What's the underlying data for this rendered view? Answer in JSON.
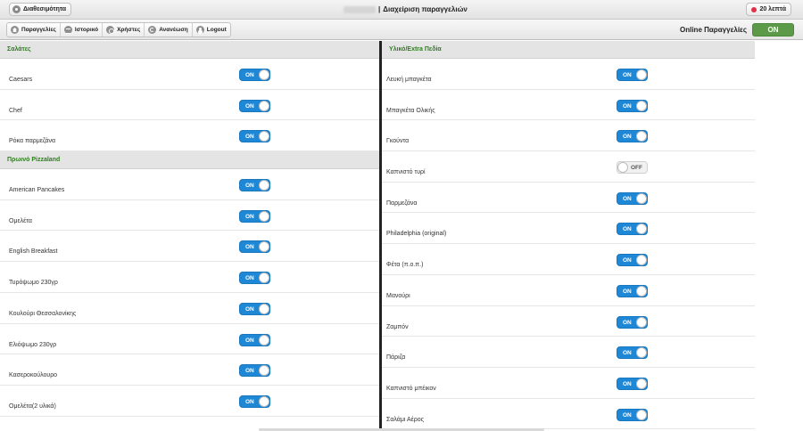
{
  "topbar": {
    "availability_label": "Διαθεσιμότητα",
    "title_prefix": "|",
    "title": "Διαχείριση παραγγελιών",
    "timer_label": "20 λεπτά"
  },
  "navbar": {
    "items": [
      {
        "label": "Παραγγελίες",
        "icon": "home-icon"
      },
      {
        "label": "Ιστορικό",
        "icon": "list-icon"
      },
      {
        "label": "Χρήστες",
        "icon": "gear-icon"
      },
      {
        "label": "Ανανέωση",
        "icon": "refresh-icon"
      },
      {
        "label": "Logout",
        "icon": "user-icon"
      }
    ],
    "online_label": "Online Παραγγελίες",
    "online_state": "ON"
  },
  "colors": {
    "accent_green": "#5c9a4a",
    "section_green": "#2e7d1f",
    "toggle_blue": "#1e88d6",
    "timer_dot": "#e0314a"
  },
  "left_column": {
    "sections": [
      {
        "header": "Σαλάτες",
        "rows": [
          {
            "label": "Caesars",
            "state": "ON"
          },
          {
            "label": "Chef",
            "state": "ON"
          },
          {
            "label": "Ρόκα παρμεζάνα",
            "state": "ON"
          }
        ]
      },
      {
        "header": "Πρωινό Pizzaland",
        "rows": [
          {
            "label": "American Pancakes",
            "state": "ON"
          },
          {
            "label": "Ομελέτα",
            "state": "ON"
          },
          {
            "label": "English Breakfast",
            "state": "ON"
          },
          {
            "label": "Τυρόψωμο 230γρ",
            "state": "ON"
          },
          {
            "label": "Κουλούρι Θεσσαλονίκης",
            "state": "ON"
          },
          {
            "label": "Ελιόψωμο 230γρ",
            "state": "ON"
          },
          {
            "label": "Κασεροκούλουρο",
            "state": "ON"
          },
          {
            "label": "Ομελέτα(2 υλικά)",
            "state": "ON"
          }
        ]
      }
    ]
  },
  "right_column": {
    "sections": [
      {
        "header": "Υλικό/Extra Πεδία",
        "rows": [
          {
            "label": "Λευκή μπαγκέτα",
            "state": "ON"
          },
          {
            "label": "Μπαγκέτα Ολικής",
            "state": "ON"
          },
          {
            "label": "Γκούντα",
            "state": "ON"
          },
          {
            "label": "Καπνιστό τυρί",
            "state": "OFF"
          },
          {
            "label": "Παρμεζάνα",
            "state": "ON"
          },
          {
            "label": "Philadelphia (original)",
            "state": "ON"
          },
          {
            "label": "Φέτα (π.ο.π.)",
            "state": "ON"
          },
          {
            "label": "Μανούρι",
            "state": "ON"
          },
          {
            "label": "Ζαμπόν",
            "state": "ON"
          },
          {
            "label": "Πάριζα",
            "state": "ON"
          },
          {
            "label": "Καπνιστό μπέικον",
            "state": "ON"
          },
          {
            "label": "Σαλάμι Αέρος",
            "state": "ON"
          }
        ]
      }
    ]
  }
}
